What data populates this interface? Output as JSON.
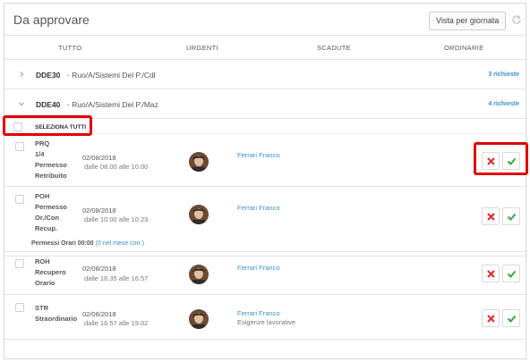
{
  "header": {
    "title": "Da approvare",
    "view_button": "Vista per giornata",
    "refresh_icon": "refresh-icon"
  },
  "tabs": [
    "TUTTO",
    "URGENTI",
    "SCADUTE",
    "ORDINARIE"
  ],
  "groups": [
    {
      "code": "DDE30",
      "desc": "- Ruo/A/Sistemi Del P./Cdl",
      "count": "3 richieste",
      "expanded": false
    },
    {
      "code": "DDE40",
      "desc": "- Ruo/A/Sistemi Del P./Maz",
      "count": "4 richieste",
      "expanded": true
    }
  ],
  "select_all": "SELEZIONA TUTTI",
  "items": [
    {
      "code_lines": [
        "PRQ",
        "1/4",
        "Permesso",
        "Retribuito"
      ],
      "date": "02/08/2018",
      "time": "dalle 08.00 alle 10.00",
      "name": "Ferrari Franco",
      "note": ""
    },
    {
      "code_lines": [
        "POH",
        "Permesso",
        "Or./Con",
        "Recup."
      ],
      "date": "02/08/2018",
      "time": "dalle 10.00 alle 10.23",
      "name": "Ferrari Franco",
      "note": ""
    },
    {
      "code_lines": [
        "ROH",
        "Recupero",
        "Orario"
      ],
      "date": "02/08/2018",
      "time": "dalle 16.35 alle 16.57",
      "name": "Ferrari Franco",
      "note": ""
    },
    {
      "code_lines": [
        "STR",
        "Straordinario"
      ],
      "date": "02/08/2018",
      "time": "dalle 16.57 alle 19.02",
      "name": "Ferrari Franco",
      "note": "Esigenze lavorative"
    }
  ],
  "permessi": {
    "label": "Permessi Orari",
    "value": "00:00",
    "link": "(0 nel mese corr.)"
  },
  "colors": {
    "link": "#3a8fc9",
    "reject": "#e03030",
    "approve": "#3aa53a",
    "highlight": "#e00000"
  }
}
